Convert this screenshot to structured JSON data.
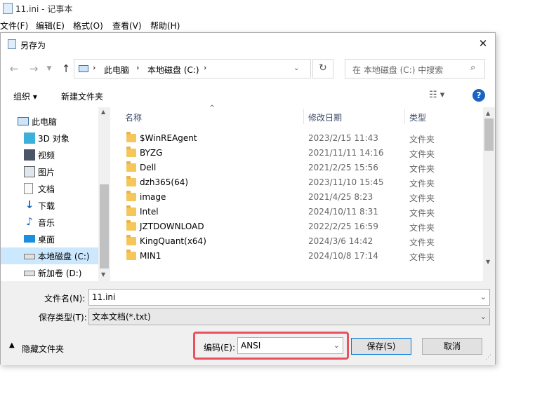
{
  "notepad": {
    "title": "11.ini - 记事本",
    "menu": [
      "文件(F)",
      "编辑(E)",
      "格式(O)",
      "查看(V)",
      "帮助(H)"
    ]
  },
  "dialog": {
    "title": "另存为",
    "close_glyph": "✕",
    "breadcrumb": [
      "此电脑",
      "本地磁盘 (C:)"
    ],
    "search_placeholder": "在 本地磁盘 (C:) 中搜索",
    "toolbar": {
      "organize": "组织 ▾",
      "new_folder": "新建文件夹"
    },
    "tree": [
      {
        "label": "此电脑",
        "icon": "pc-icon"
      },
      {
        "label": "3D 对象",
        "icon": "3d-objects-icon"
      },
      {
        "label": "视频",
        "icon": "video-icon"
      },
      {
        "label": "图片",
        "icon": "pictures-icon"
      },
      {
        "label": "文档",
        "icon": "documents-icon"
      },
      {
        "label": "下载",
        "icon": "download-icon"
      },
      {
        "label": "音乐",
        "icon": "music-icon"
      },
      {
        "label": "桌面",
        "icon": "desktop-icon"
      },
      {
        "label": "本地磁盘 (C:)",
        "icon": "drive-icon"
      },
      {
        "label": "新加卷 (D:)",
        "icon": "drive-icon"
      }
    ],
    "columns": {
      "name": "名称",
      "date": "修改日期",
      "type": "类型"
    },
    "files": [
      {
        "name": "$WinREAgent",
        "date": "2023/2/15 11:43",
        "type": "文件夹"
      },
      {
        "name": "BYZG",
        "date": "2021/11/11 14:16",
        "type": "文件夹"
      },
      {
        "name": "Dell",
        "date": "2021/2/25 15:56",
        "type": "文件夹"
      },
      {
        "name": "dzh365(64)",
        "date": "2023/11/10 15:45",
        "type": "文件夹"
      },
      {
        "name": "image",
        "date": "2021/4/25 8:23",
        "type": "文件夹"
      },
      {
        "name": "Intel",
        "date": "2024/10/11 8:31",
        "type": "文件夹"
      },
      {
        "name": "JZTDOWNLOAD",
        "date": "2022/2/25 16:59",
        "type": "文件夹"
      },
      {
        "name": "KingQuant(x64)",
        "date": "2024/3/6 14:42",
        "type": "文件夹"
      },
      {
        "name": "MIN1",
        "date": "2024/10/8 17:14",
        "type": "文件夹"
      }
    ],
    "filename_label": "文件名(N):",
    "filename_value": "11.ini",
    "savetype_label": "保存类型(T):",
    "savetype_value": "文本文档(*.txt)",
    "hide_folders": "隐藏文件夹",
    "encoding_label": "编码(E):",
    "encoding_value": "ANSI",
    "save_button": "保存(S)",
    "cancel_button": "取消",
    "highlight_color": "#e8515d"
  }
}
